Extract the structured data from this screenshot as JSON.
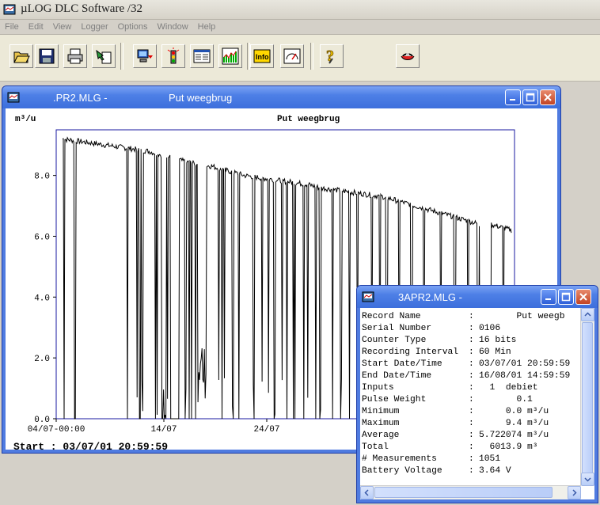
{
  "app": {
    "title": "µLOG DLC Software /32"
  },
  "menu": [
    "File",
    "Edit",
    "View",
    "Logger",
    "Options",
    "Window",
    "Help"
  ],
  "toolbar": {
    "buttons": [
      "open-folder-icon",
      "save-disk-icon",
      "print-icon",
      "export-icon",
      "download-icon",
      "signal-icon",
      "display-icon",
      "graph-icon",
      "info-icon",
      "gauge-icon",
      "help-icon",
      "exit-icon"
    ],
    "info_label": "Info"
  },
  "chart_window": {
    "title_left": ".PR2.MLG -",
    "title_right": "Put weegbrug"
  },
  "chart_data": {
    "type": "line",
    "title": "Put weegbrug",
    "ylabel": "m³/u",
    "ylim": [
      0,
      9.5
    ],
    "yticks": [
      "0.0",
      "2.0",
      "4.0",
      "6.0",
      "8.0"
    ],
    "xticks": [
      "04/07-00:00",
      "14/07",
      "24/07"
    ],
    "grid": false,
    "series": [
      {
        "values": [
          9.2,
          9.15,
          9.1,
          9.05,
          9.0,
          8.95,
          8.9,
          8.85,
          8.8,
          8.7,
          8.6,
          8.5,
          8.4,
          8.35,
          8.3,
          8.2,
          8.1,
          8.0,
          7.95,
          7.9,
          7.85,
          7.8,
          7.75,
          7.7,
          7.6,
          7.55,
          7.5,
          7.45,
          7.4,
          7.35,
          7.3,
          7.2,
          7.1,
          7.0,
          6.9,
          6.8,
          6.7,
          6.6,
          6.5,
          6.4,
          6.4,
          6.3,
          6.2
        ],
        "dips": [
          0.02,
          0.15,
          0.78,
          0.9,
          0.93,
          0.96,
          1.12,
          1.14,
          1.2,
          1.22,
          1.24,
          1.26,
          1.3,
          1.33,
          1.48,
          1.52,
          1.55,
          1.6,
          1.7,
          1.88,
          1.92,
          1.95,
          2.05,
          2.12,
          2.3,
          2.4,
          2.48,
          2.55,
          2.64,
          2.7,
          2.78,
          2.8,
          2.9,
          2.95,
          3.05,
          3.1,
          3.25,
          3.35,
          3.45,
          3.55,
          3.72,
          3.82,
          3.9,
          4.05,
          4.2,
          4.35,
          4.55,
          4.72,
          4.88,
          5.0,
          5.15,
          5.3
        ]
      }
    ],
    "footer": "Start : 03/07/01 20:59:59"
  },
  "info_window": {
    "title": "3APR2.MLG -",
    "rows": [
      {
        "label": "Record Name",
        "value": "       Put weegb"
      },
      {
        "label": "Serial Number",
        "value": "0106"
      },
      {
        "label": "Counter Type",
        "value": "16 bits"
      },
      {
        "label": "Recording Interval",
        "value": "60 Min"
      },
      {
        "label": "Start Date/Time",
        "value": "03/07/01 20:59:59"
      },
      {
        "label": "End Date/Time",
        "value": "16/08/01 14:59:59"
      },
      {
        "label": "Inputs",
        "value": "  1  debiet"
      },
      {
        "label": "Pulse Weight",
        "value": "       0.1"
      },
      {
        "label": "Minimum",
        "value": "     0.0 m³/u"
      },
      {
        "label": "Maximum",
        "value": "     9.4 m³/u"
      },
      {
        "label": "Average",
        "value": "5.722074 m³/u"
      },
      {
        "label": "Total",
        "value": "  6013.9 m³"
      },
      {
        "label": "# Measurements",
        "value": "1051"
      },
      {
        "label": "Battery Voltage",
        "value": "3.64 V"
      }
    ],
    "separator": ":"
  }
}
